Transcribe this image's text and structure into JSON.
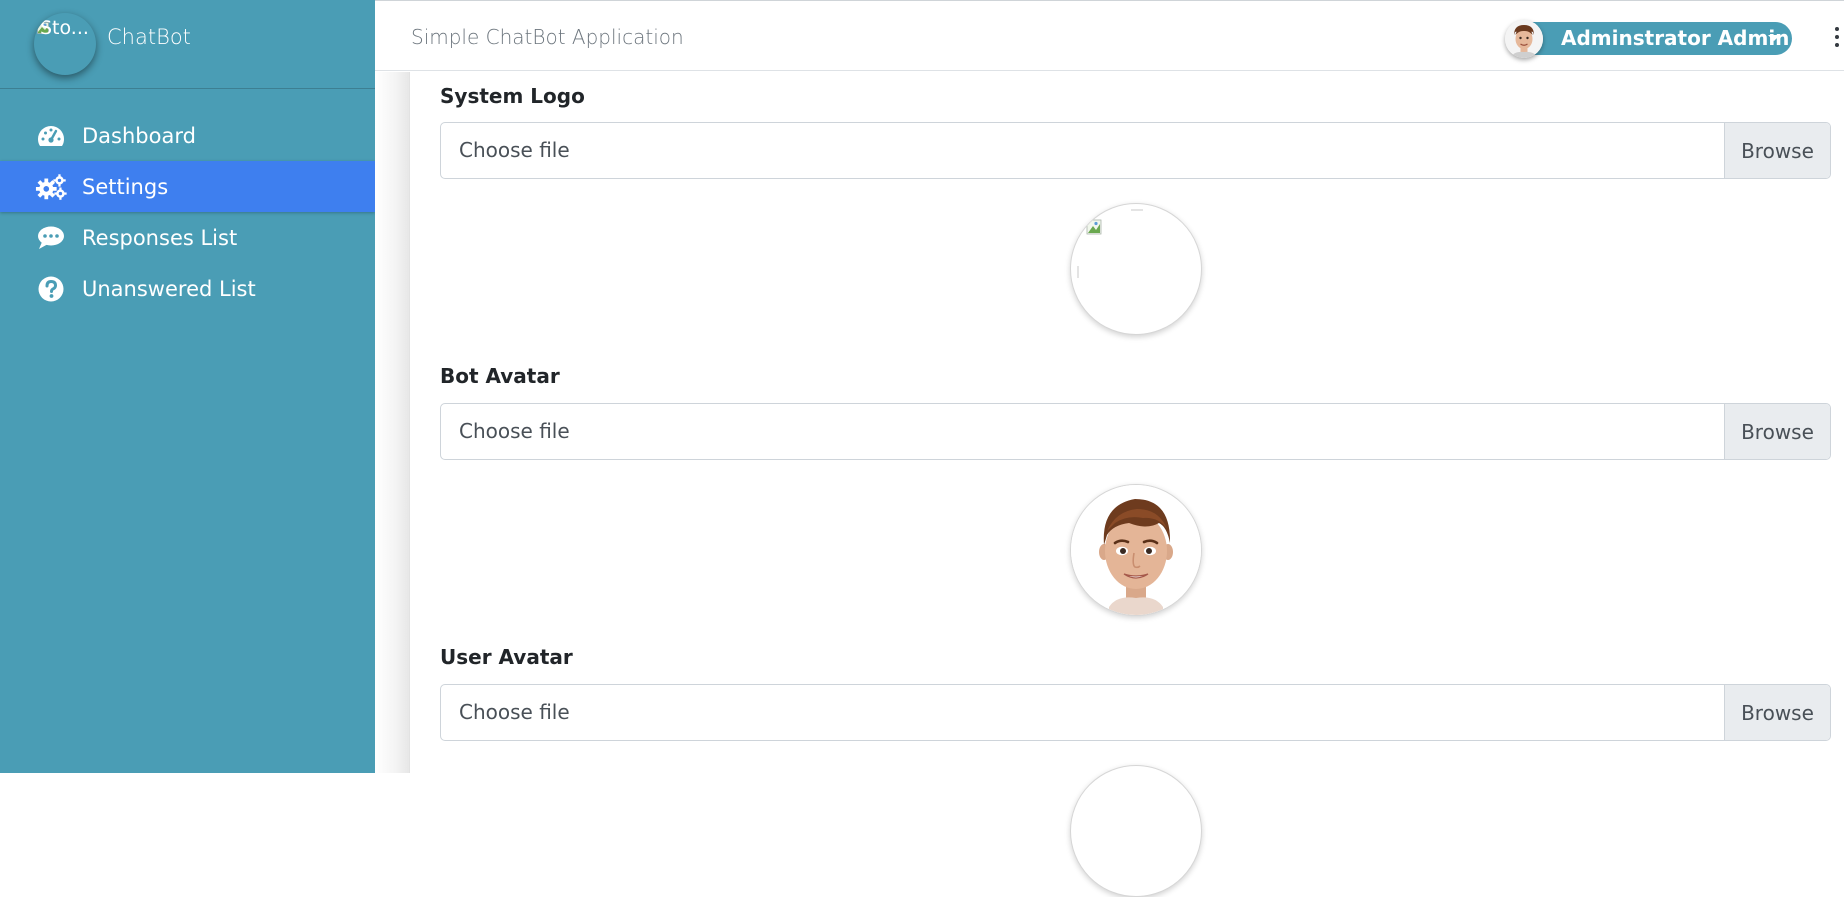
{
  "brand": {
    "logo_alt": "Sto...",
    "name": "ChatBot"
  },
  "sidebar": {
    "items": [
      {
        "label": "Dashboard",
        "icon": "tachometer-icon",
        "active": false
      },
      {
        "label": "Settings",
        "icon": "gears-icon",
        "active": true
      },
      {
        "label": "Responses List",
        "icon": "comment-icon",
        "active": false
      },
      {
        "label": "Unanswered List",
        "icon": "question-circle-icon",
        "active": false
      }
    ]
  },
  "header": {
    "title": "Simple ChatBot Application",
    "user_name": "Adminstrator Admin"
  },
  "settings": {
    "system_logo": {
      "label": "System Logo",
      "placeholder": "Choose file",
      "browse": "Browse"
    },
    "bot_avatar": {
      "label": "Bot Avatar",
      "placeholder": "Choose file",
      "browse": "Browse"
    },
    "user_avatar": {
      "label": "User Avatar",
      "placeholder": "Choose file",
      "browse": "Browse"
    }
  },
  "colors": {
    "sidebar_bg": "#4a9db5",
    "active_item": "#3e7fef",
    "accent": "#4a9db5"
  }
}
